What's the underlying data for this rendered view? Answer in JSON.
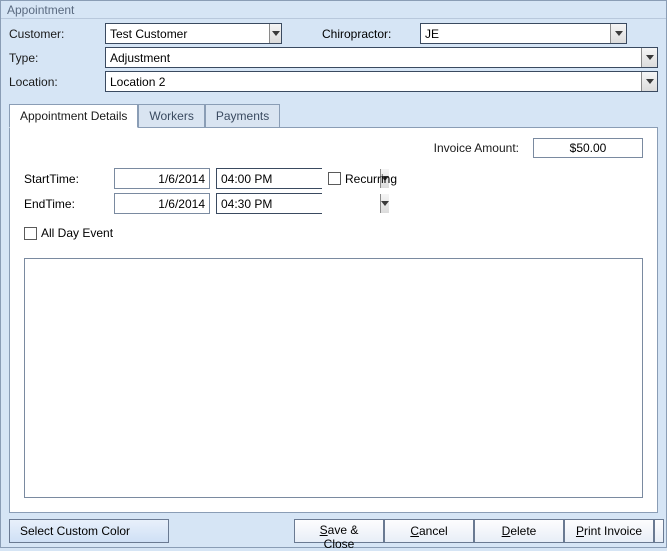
{
  "window": {
    "title": "Appointment"
  },
  "form": {
    "customer": {
      "label": "Customer:",
      "value": "Test Customer"
    },
    "chiropractor": {
      "label": "Chiropractor:",
      "value": "JE"
    },
    "type": {
      "label": "Type:",
      "value": "Adjustment"
    },
    "location": {
      "label": "Location:",
      "value": "Location 2"
    }
  },
  "tabs": {
    "details": "Appointment Details",
    "workers": "Workers",
    "payments": "Payments"
  },
  "details": {
    "invoice_label": "Invoice Amount:",
    "invoice_value": "$50.00",
    "start_label": "StartTime:",
    "start_date": "1/6/2014",
    "start_time": "04:00 PM",
    "end_label": "EndTime:",
    "end_date": "1/6/2014",
    "end_time": "04:30 PM",
    "recurring_label": "Recurring",
    "allday_label": "All Day Event"
  },
  "buttons": {
    "color": "Select Custom Color",
    "save": {
      "u": "S",
      "rest": "ave & Close"
    },
    "cancel": {
      "u": "C",
      "rest": "ancel"
    },
    "delete": {
      "u": "D",
      "rest": "elete"
    },
    "print": {
      "u": "P",
      "rest": "rint Invoice"
    }
  }
}
